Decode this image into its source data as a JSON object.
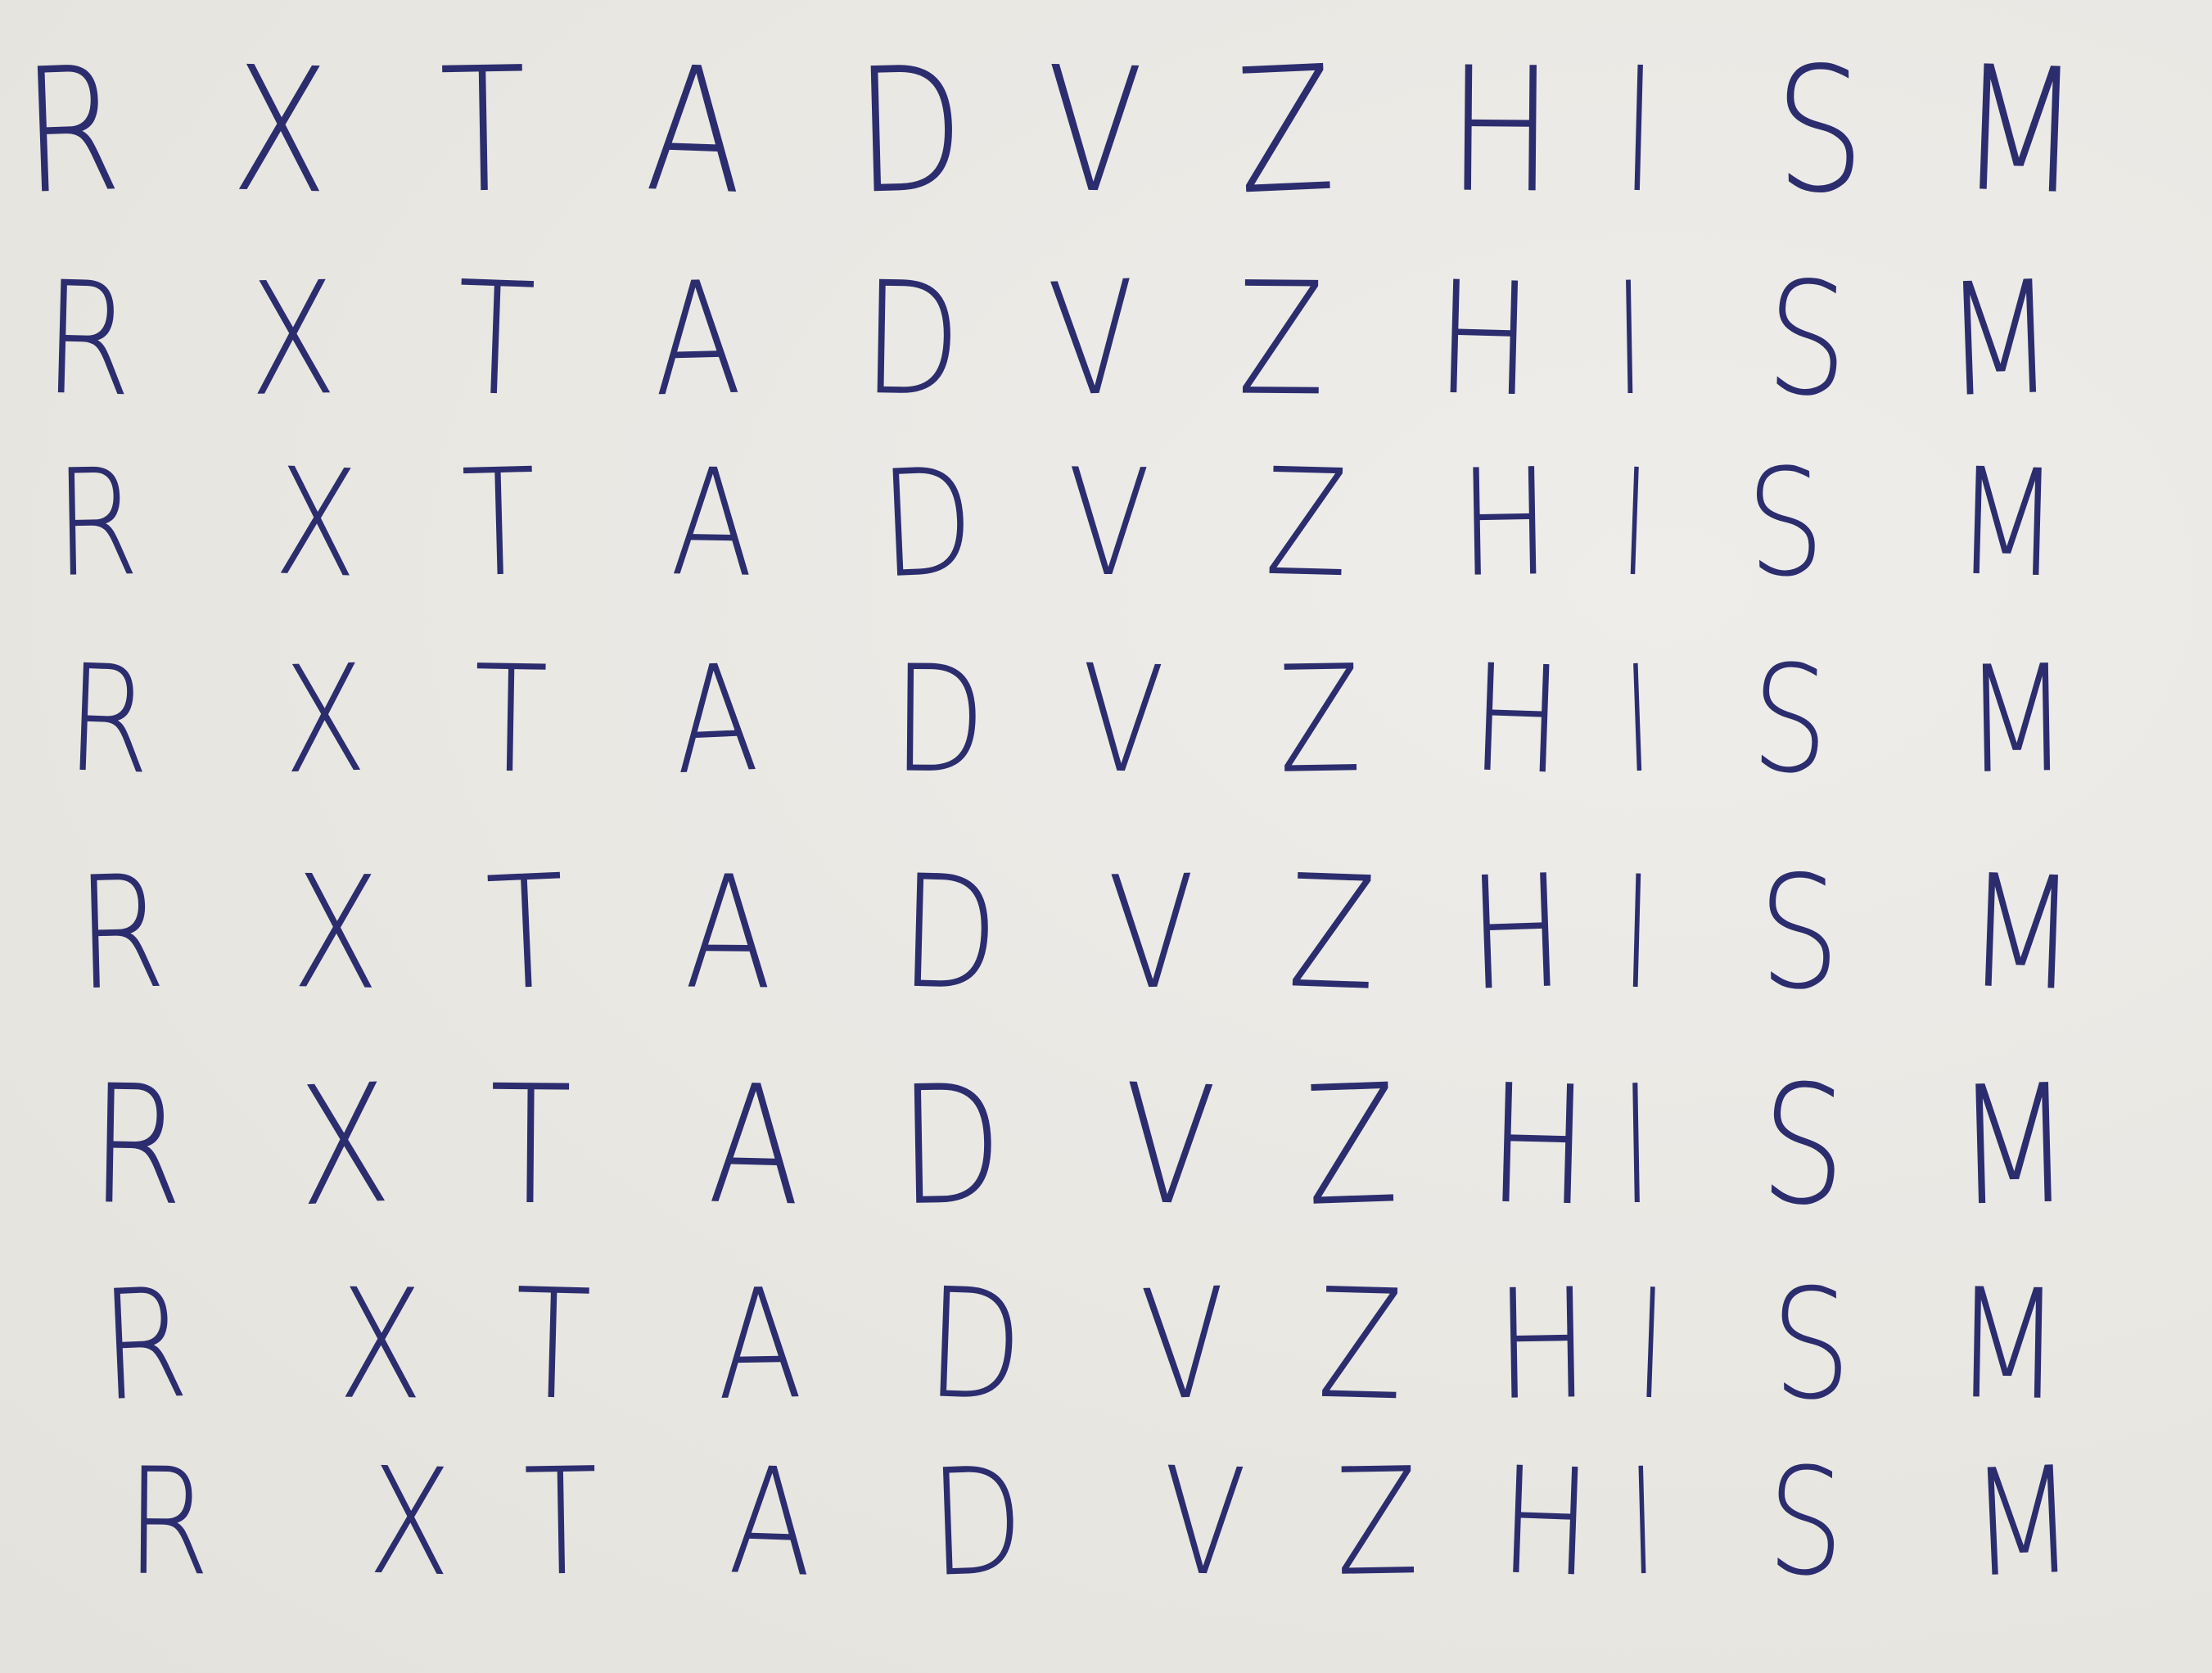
{
  "sheet": {
    "ink_color": "#2c2d6e",
    "paper_color": "#ebe9e4",
    "rows": [
      [
        "R",
        "X",
        "T",
        "A",
        "D",
        "V",
        "Z",
        "H",
        "I",
        "S",
        "M"
      ],
      [
        "R",
        "X",
        "T",
        "A",
        "D",
        "V",
        "Z",
        "H",
        "I",
        "S",
        "M"
      ],
      [
        "R",
        "X",
        "T",
        "A",
        "D",
        "V",
        "Z",
        "H",
        "I",
        "S",
        "M"
      ],
      [
        "R",
        "X",
        "T",
        "A",
        "D",
        "V",
        "Z",
        "H",
        "I",
        "S",
        "M"
      ],
      [
        "R",
        "X",
        "T",
        "A",
        "D",
        "V",
        "Z",
        "H",
        "I",
        "S",
        "M"
      ],
      [
        "R",
        "X",
        "T",
        "A",
        "D",
        "V",
        "Z",
        "H",
        "I",
        "S",
        "M"
      ],
      [
        "R",
        "X",
        "T",
        "A",
        "D",
        "V",
        "Z",
        "H",
        "I",
        "S",
        "M"
      ],
      [
        "R",
        "X",
        "T",
        "A",
        "D",
        "V",
        "Z",
        "H",
        "I",
        "S",
        "M"
      ]
    ]
  }
}
